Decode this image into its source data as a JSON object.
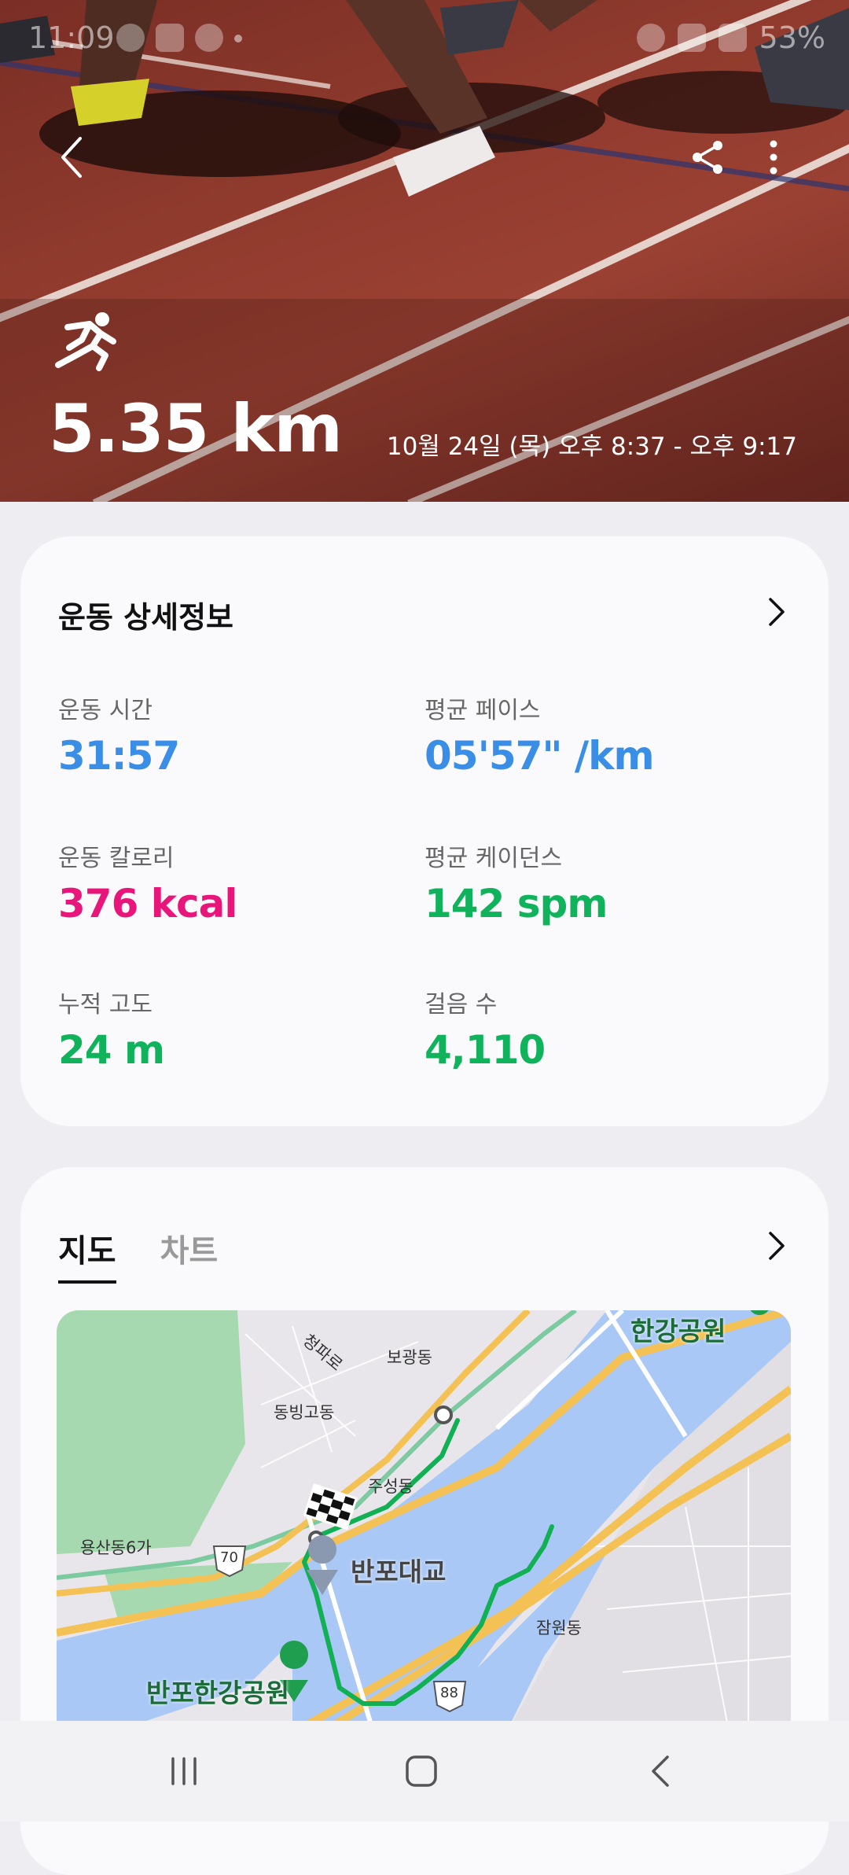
{
  "status": {
    "time": "11:09",
    "battery": "53%"
  },
  "workout": {
    "distance": "5.35 km",
    "date_range": "10월 24일 (목) 오후 8:37 - 오후 9:17"
  },
  "details": {
    "title": "운동 상세정보",
    "metrics": [
      {
        "label": "운동 시간",
        "value": "31:57",
        "color": "#3a8ee6"
      },
      {
        "label": "평균 페이스",
        "value": "05'57\" /km",
        "color": "#3a8ee6"
      },
      {
        "label": "운동 칼로리",
        "value": "376 kcal",
        "color": "#e8157a"
      },
      {
        "label": "평균 케이던스",
        "value": "142 spm",
        "color": "#10b35c"
      },
      {
        "label": "누적 고도",
        "value": "24 m",
        "color": "#10b35c"
      },
      {
        "label": "걸음 수",
        "value": "4,110",
        "color": "#10b35c"
      }
    ]
  },
  "map_section": {
    "tabs": [
      "지도",
      "차트"
    ],
    "active_tab": "지도",
    "labels": {
      "hangang_park": "한강공원",
      "cheongpa": "청파로",
      "bogwang": "보광동",
      "dongbinggo": "동빙고동",
      "juseong": "주성동",
      "yongsan6": "용산동6가",
      "banpo_bridge": "반포대교",
      "jamwon": "잠원동",
      "banpo_park": "반포한강공원",
      "route_70": "70",
      "route_88": "88"
    }
  },
  "icons": {
    "back": "back-icon",
    "share": "share-icon",
    "more": "more-vertical-icon",
    "activity": "running-icon",
    "chevron": "chevron-right-icon"
  }
}
